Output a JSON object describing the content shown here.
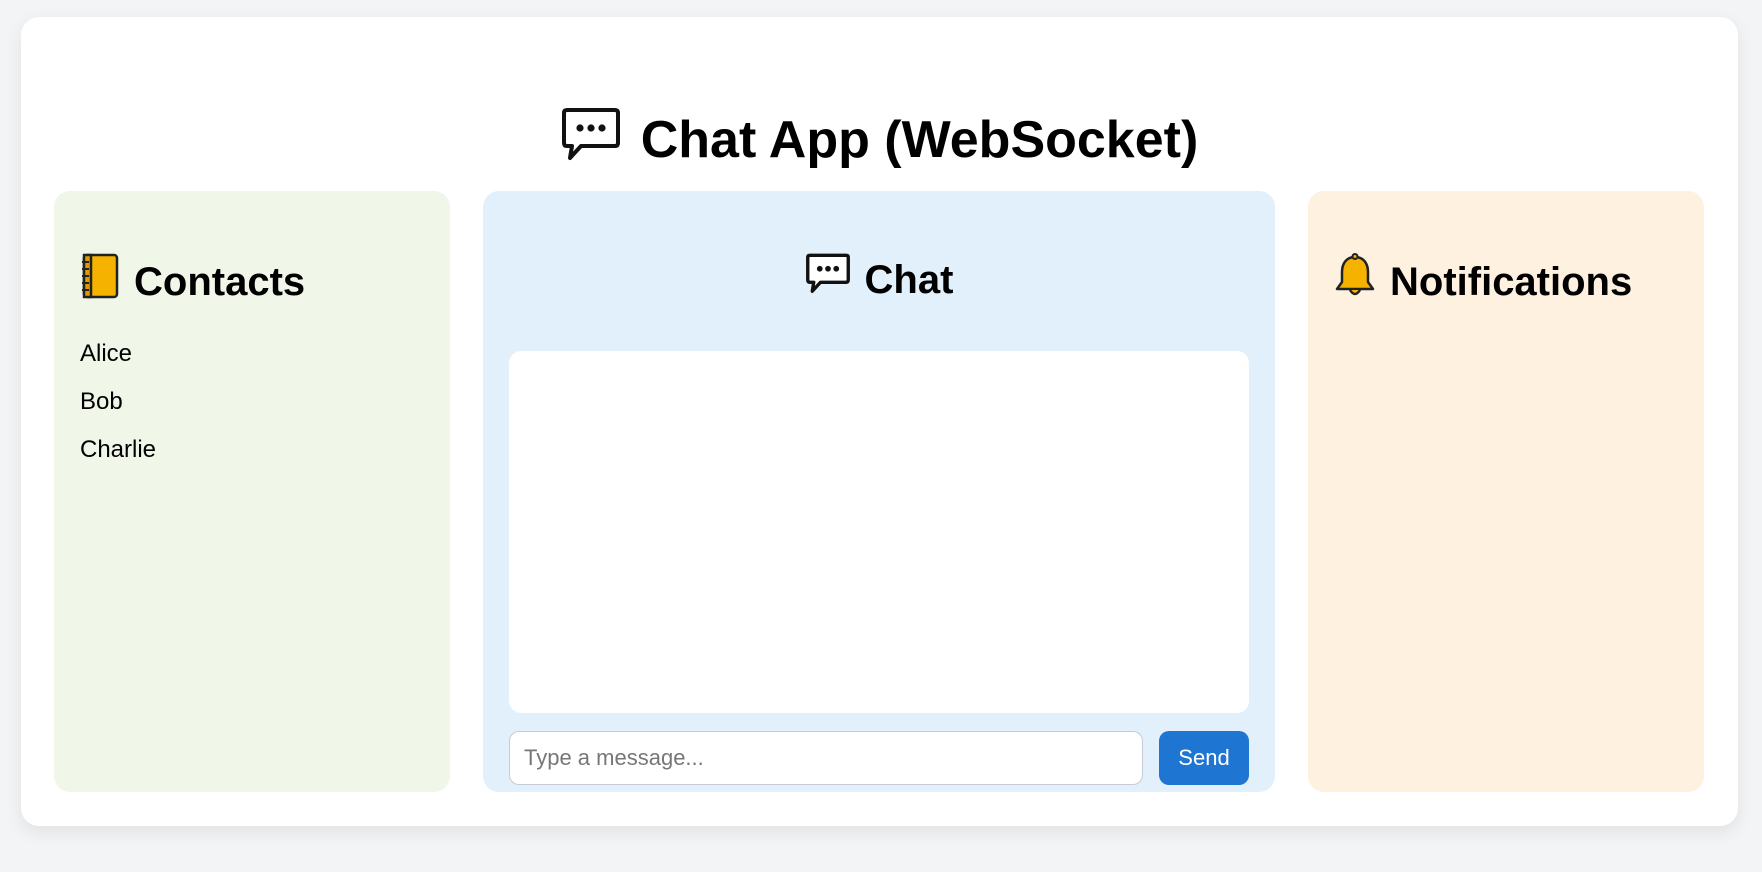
{
  "app": {
    "title": "Chat App (WebSocket)",
    "title_icon": "speech-balloon-icon"
  },
  "contacts": {
    "heading": "Contacts",
    "heading_icon": "ledger-notebook-icon",
    "items": [
      {
        "name": "Alice"
      },
      {
        "name": "Bob"
      },
      {
        "name": "Charlie"
      }
    ]
  },
  "chat": {
    "heading": "Chat",
    "heading_icon": "speech-balloon-icon",
    "messages": [],
    "input": {
      "value": "",
      "placeholder": "Type a message..."
    },
    "send_label": "Send"
  },
  "notifications": {
    "heading": "Notifications",
    "heading_icon": "bell-icon",
    "items": []
  },
  "colors": {
    "page_background": "#f3f4f6",
    "card_background": "#ffffff",
    "contacts_panel": "#f0f6e8",
    "chat_panel": "#e2f0fb",
    "notifications_panel": "#fef1e0",
    "send_button": "#1f76d2",
    "notebook_icon": "#f5b300",
    "bell_icon": "#f5b300"
  }
}
